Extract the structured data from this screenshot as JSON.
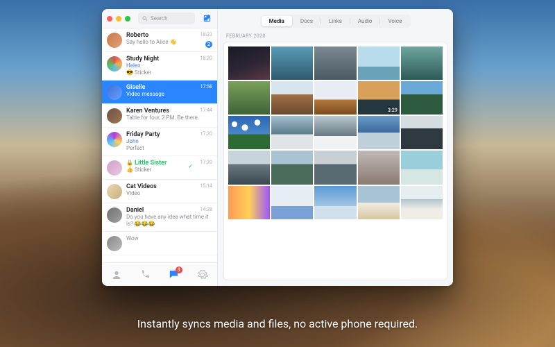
{
  "search": {
    "placeholder": "Search"
  },
  "tabs": {
    "items": [
      "Media",
      "Docs",
      "Links",
      "Audio",
      "Voice"
    ],
    "active": 0
  },
  "date_header": "FEBRUARY 2020",
  "chats": [
    {
      "name": "Roberto",
      "preview": "Say hello to Alice 👋",
      "time": "18:23",
      "badge": "2"
    },
    {
      "name": "Study Night",
      "from": "Helen",
      "preview": "😎 Sticker",
      "time": "18:20"
    },
    {
      "name": "Giselle",
      "preview": "Video message",
      "time": "17:56",
      "selected": true
    },
    {
      "name": "Karen Ventures",
      "preview": "Table for four, 2 PM. Be there.",
      "time": "17:44"
    },
    {
      "name": "Friday Party",
      "from": "John",
      "preview": "Perfect",
      "time": "17:20"
    },
    {
      "name": "Little Sister",
      "preview": "👍 Sticker",
      "time": "17:20",
      "verified": true,
      "lock": true,
      "check": true
    },
    {
      "name": "Cat Videos",
      "preview": "Video",
      "time": "15:14"
    },
    {
      "name": "Daniel",
      "preview": "Do you have any idea what time it is? 😂😂😂",
      "time": "14:28"
    },
    {
      "name": "",
      "preview": "Wow",
      "time": ""
    }
  ],
  "bottom_tabs": {
    "chat_badge": "3"
  },
  "media": [
    {},
    {},
    {},
    {},
    {},
    {},
    {},
    {},
    {
      "duration": "3:29"
    },
    {},
    {},
    {},
    {},
    {},
    {},
    {},
    {},
    {},
    {},
    {},
    {},
    {},
    {},
    {},
    {}
  ],
  "caption": "Instantly syncs media and files, no active phone required."
}
